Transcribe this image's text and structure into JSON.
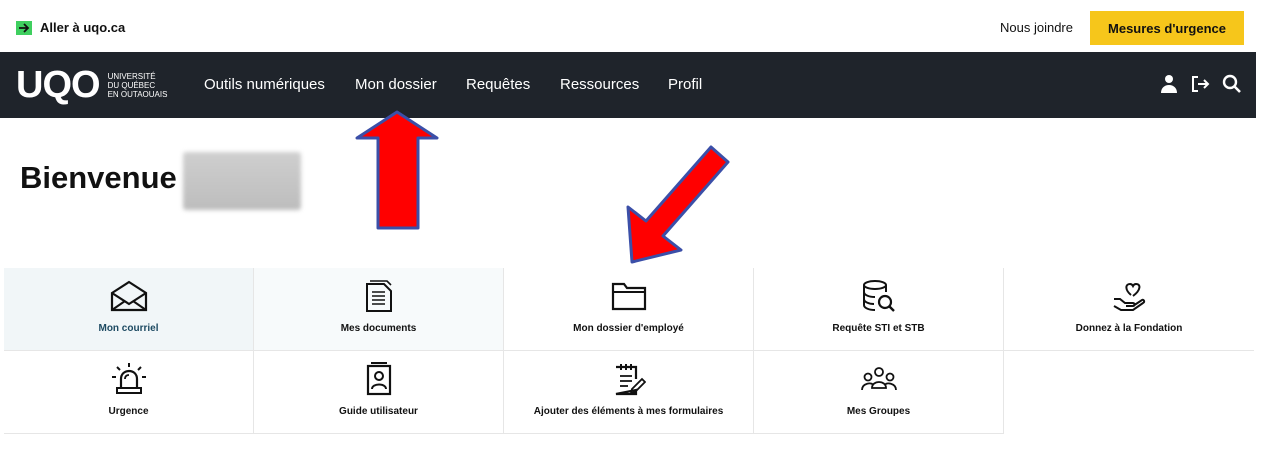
{
  "utility": {
    "skip_label": "Aller à uqo.ca",
    "contact_label": "Nous joindre",
    "emergency_label": "Mesures d'urgence"
  },
  "nav": {
    "logo_mark": "UQO",
    "logo_line1": "UNIVERSITÉ",
    "logo_line2": "DU QUÉBEC",
    "logo_line3": "EN OUTAOUAIS",
    "items": [
      "Outils numériques",
      "Mon dossier",
      "Requêtes",
      "Ressources",
      "Profil"
    ]
  },
  "welcome": {
    "title": "Bienvenue"
  },
  "tiles": [
    {
      "label": "Mon courriel",
      "icon": "envelope-icon"
    },
    {
      "label": "Mes documents",
      "icon": "document-icon"
    },
    {
      "label": "Mon dossier d'employé",
      "icon": "folder-icon"
    },
    {
      "label": "Requête STI et STB",
      "icon": "database-search-icon"
    },
    {
      "label": "Donnez à la Fondation",
      "icon": "heart-hand-icon"
    },
    {
      "label": "Urgence",
      "icon": "alarm-light-icon"
    },
    {
      "label": "Guide utilisateur",
      "icon": "user-guide-icon"
    },
    {
      "label": "Ajouter des éléments à mes formulaires",
      "icon": "edit-form-icon"
    },
    {
      "label": "Mes Groupes",
      "icon": "group-icon"
    }
  ],
  "colors": {
    "nav_bg": "#1f242b",
    "emergency_bg": "#f6c61b",
    "skip_icon_bg": "#3fcf5f",
    "active_tile_bg": "#f1f6f8",
    "annotation_arrow": "#ff0000",
    "annotation_outline": "#3b4fa8"
  }
}
